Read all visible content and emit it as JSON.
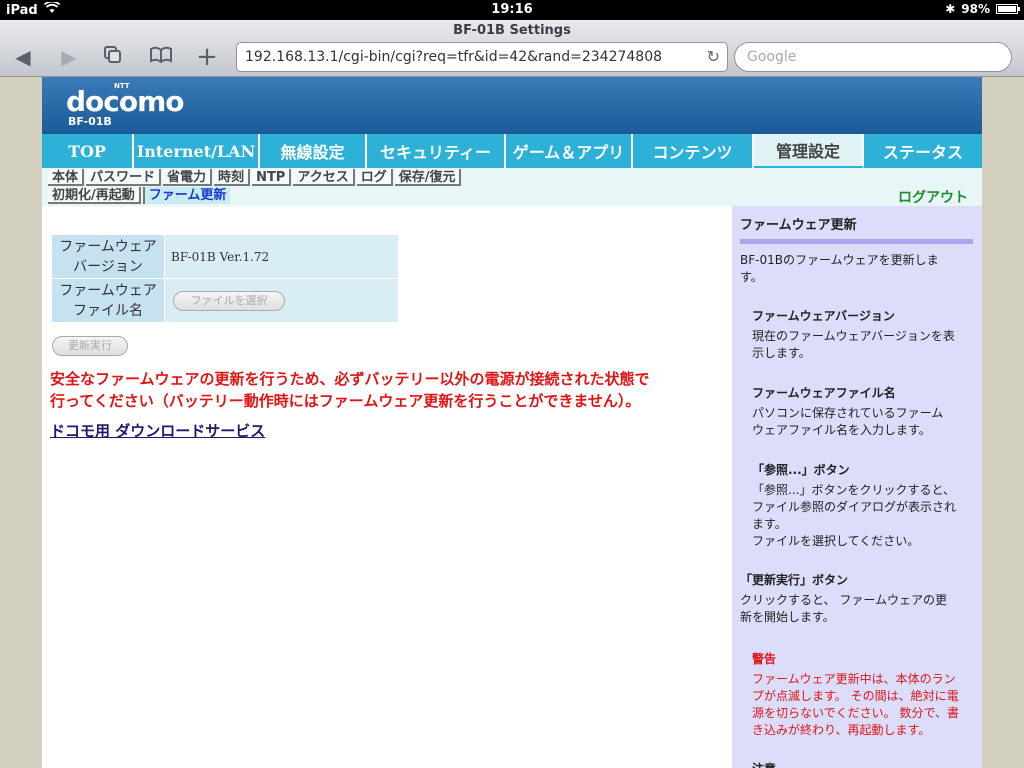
{
  "status_bar": {
    "device": "iPad",
    "time": "19:16",
    "battery": "98%",
    "battery_level": 0.98
  },
  "browser": {
    "title": "BF-01B Settings",
    "url": "192.168.13.1/cgi-bin/cgi?req=tfr&id=42&rand=234274808",
    "search_placeholder": "Google"
  },
  "brand": {
    "logo": "docomo",
    "logo_super": "NTT",
    "model": "BF-01B"
  },
  "main_nav": [
    "TOP",
    "Internet/LAN",
    "無線設定",
    "セキュリティー",
    "ゲーム＆アプリ",
    "コンテンツ",
    "管理設定",
    "ステータス"
  ],
  "sub_nav": {
    "row1": [
      "本体",
      "パスワード",
      "省電力",
      "時刻",
      "NTP",
      "アクセス",
      "ログ",
      "保存/復元"
    ],
    "row2": [
      "初期化/再起動",
      "ファーム更新"
    ]
  },
  "logout": "ログアウト",
  "form": {
    "version_label_1": "ファームウェア",
    "version_label_2": "バージョン",
    "version_value": "BF-01B Ver.1.72",
    "file_label_1": "ファームウェア",
    "file_label_2": "ファイル名",
    "file_button": "ファイルを選択",
    "run_button": "更新実行"
  },
  "warning": {
    "line1": "安全なファームウェアの更新を行うため、必ずバッテリー以外の電源が接続された状態で",
    "line2": "行ってください（バッテリー動作時にはファームウェア更新を行うことができません）。"
  },
  "download_link": "ドコモ用 ダウンロードサービス",
  "help": {
    "title": "ファームウェア更新",
    "intro_1": "BF-01Bのファームウェアを更新しま",
    "intro_2": "す。",
    "s1_title": "ファームウェアバージョン",
    "s1_1": "現在のファームウェアバージョンを表",
    "s1_2": "示します。",
    "s2_title": "ファームウェアファイル名",
    "s2_1": "パソコンに保存されているファーム",
    "s2_2": "ウェアファイル名を入力します。",
    "s3_title": "「参照...」ボタン",
    "s3_1": "「参照...」ボタンをクリックすると、",
    "s3_2": "ファイル参照のダイアログが表示され",
    "s3_3": "ます。",
    "s3_4": "ファイルを選択してください。",
    "s4_title": "「更新実行」ボタン",
    "s4_1": "クリックすると、 ファームウェアの更",
    "s4_2": "新を開始します。",
    "s5_title": "警告",
    "s5_1": "ファームウェア更新中は、本体のラン",
    "s5_2": "プが点滅します。 その間は、絶対に電",
    "s5_3": "源を切らないでください。 数分で、書",
    "s5_4": "き込みが終わり、再起動します。",
    "s6_title": "注意"
  }
}
